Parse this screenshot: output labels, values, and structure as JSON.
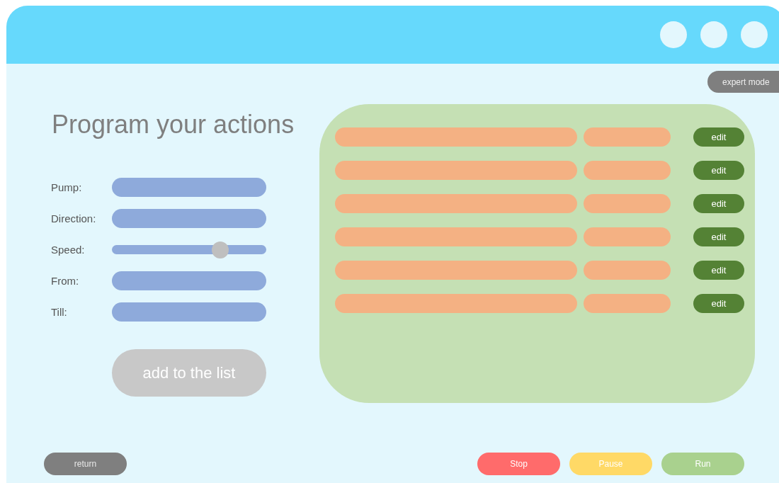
{
  "window": {
    "controls": [
      {
        "kind": "circle"
      },
      {
        "kind": "circle"
      },
      {
        "kind": "circle"
      }
    ]
  },
  "expert_button": "expert mode",
  "title": "Program your actions",
  "form": [
    {
      "label": "Pump:",
      "kind": "input"
    },
    {
      "label": "Direction:",
      "kind": "input"
    },
    {
      "label": "Speed:",
      "kind": "slider",
      "level": 0.7
    },
    {
      "label": "From:",
      "kind": "input"
    },
    {
      "label": "Till:",
      "kind": "input"
    }
  ],
  "add_button": {
    "label": "add to the list",
    "disabled": true
  },
  "action_list": [
    {
      "edit": "edit"
    },
    {
      "edit": "edit"
    },
    {
      "edit": "edit"
    },
    {
      "edit": "edit"
    },
    {
      "edit": "edit"
    },
    {
      "edit": "edit"
    }
  ],
  "return_button": "return",
  "controls": [
    {
      "label": "Stop",
      "color": "#ff6b6b"
    },
    {
      "label": "Pause",
      "color": "#ffd966"
    },
    {
      "label": "Run",
      "color": "#a9d18e"
    }
  ]
}
